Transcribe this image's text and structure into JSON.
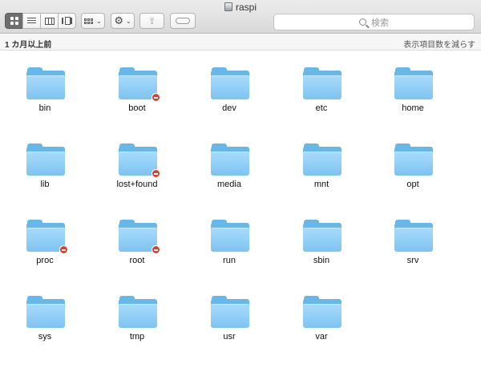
{
  "window": {
    "title": "raspi"
  },
  "toolbar": {
    "view_buttons": [
      "icon-view",
      "list-view",
      "column-view",
      "coverflow-view"
    ],
    "active_view": "icon-view",
    "group_chevron": "⌄",
    "action_chevron": "⌄",
    "gear_glyph": "⚙",
    "share_glyph": "⇪"
  },
  "search": {
    "placeholder": "検索"
  },
  "pathbar": {
    "group_title": "1 カ月以上前",
    "reduce_label": "表示項目数を減らす"
  },
  "folders": [
    {
      "name": "bin",
      "restricted": false
    },
    {
      "name": "boot",
      "restricted": true
    },
    {
      "name": "dev",
      "restricted": false
    },
    {
      "name": "etc",
      "restricted": false
    },
    {
      "name": "home",
      "restricted": false
    },
    {
      "name": "lib",
      "restricted": false
    },
    {
      "name": "lost+found",
      "restricted": true
    },
    {
      "name": "media",
      "restricted": false
    },
    {
      "name": "mnt",
      "restricted": false
    },
    {
      "name": "opt",
      "restricted": false
    },
    {
      "name": "proc",
      "restricted": true
    },
    {
      "name": "root",
      "restricted": true
    },
    {
      "name": "run",
      "restricted": false
    },
    {
      "name": "sbin",
      "restricted": false
    },
    {
      "name": "srv",
      "restricted": false
    },
    {
      "name": "sys",
      "restricted": false
    },
    {
      "name": "tmp",
      "restricted": false
    },
    {
      "name": "usr",
      "restricted": false
    },
    {
      "name": "var",
      "restricted": false
    }
  ],
  "colors": {
    "folder_front": "#8fccf5",
    "folder_back": "#66b7ea",
    "restricted_badge": "#d9412f"
  }
}
